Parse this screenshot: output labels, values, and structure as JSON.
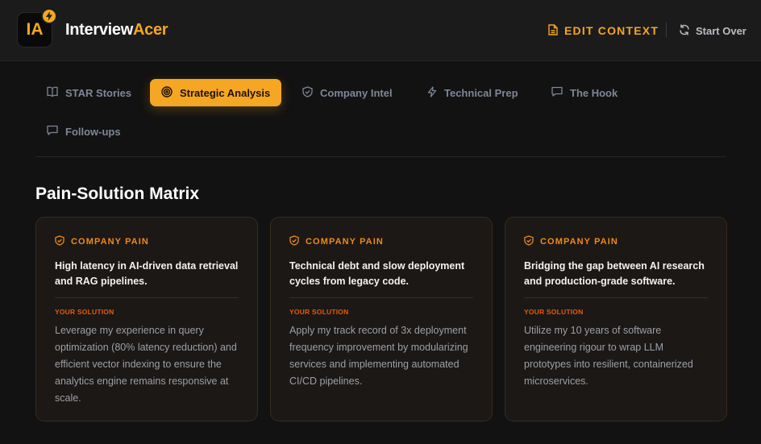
{
  "app": {
    "logo_text": "IA",
    "brand_white": "Interview",
    "brand_orange": "Acer"
  },
  "header": {
    "edit_context_label": "EDIT CONTEXT",
    "start_over_label": "Start Over"
  },
  "tabs": [
    {
      "label": "STAR Stories",
      "icon": "book-icon",
      "active": false
    },
    {
      "label": "Strategic Analysis",
      "icon": "target-icon",
      "active": true
    },
    {
      "label": "Company Intel",
      "icon": "shield-icon",
      "active": false
    },
    {
      "label": "Technical Prep",
      "icon": "bolt-icon",
      "active": false
    },
    {
      "label": "The Hook",
      "icon": "message-icon",
      "active": false
    },
    {
      "label": "Follow-ups",
      "icon": "message-icon",
      "active": false
    }
  ],
  "main": {
    "section_title": "Pain-Solution Matrix",
    "cards": [
      {
        "pain_label": "COMPANY PAIN",
        "pain": "High latency in AI-driven data retrieval and RAG pipelines.",
        "solution_label": "YOUR SOLUTION",
        "solution": "Leverage my experience in query optimization (80% latency reduction) and efficient vector indexing to ensure the analytics engine remains responsive at scale."
      },
      {
        "pain_label": "COMPANY PAIN",
        "pain": "Technical debt and slow deployment cycles from legacy code.",
        "solution_label": "YOUR SOLUTION",
        "solution": "Apply my track record of 3x deployment frequency improvement by modularizing services and implementing automated CI/CD pipelines."
      },
      {
        "pain_label": "COMPANY PAIN",
        "pain": "Bridging the gap between AI research and production-grade software.",
        "solution_label": "YOUR SOLUTION",
        "solution": "Utilize my 10 years of software engineering rigour to wrap LLM prototypes into resilient, containerized microservices."
      }
    ]
  },
  "colors": {
    "accent": "#f5a623",
    "pain_label": "#f0891a",
    "solution_label": "#e8590c",
    "background": "#121212"
  }
}
